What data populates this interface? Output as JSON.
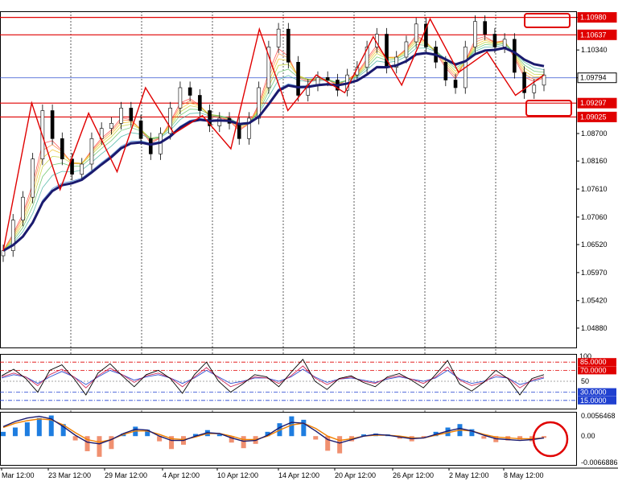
{
  "chart_data": [
    {
      "type": "candlestick",
      "title": "",
      "x": [
        "Mar 12:00",
        "23 Mar 12:00",
        "29 Mar 12:00",
        "4 Apr 12:00",
        "10 Apr 12:00",
        "14 Apr 12:00",
        "20 Apr 12:00",
        "26 Apr 12:00",
        "2 May 12:00",
        "8 May 12:00"
      ],
      "ylim": [
        1.045,
        1.111
      ],
      "ticks": [
        "1.10980",
        "1.10340",
        "1.09794",
        "1.08700",
        "1.08160",
        "1.07610",
        "1.07060",
        "1.06520",
        "1.05970",
        "1.05420",
        "1.04880"
      ],
      "closes": [
        1.064,
        1.07,
        1.0745,
        1.082,
        1.0915,
        1.086,
        1.082,
        1.079,
        1.081,
        1.086,
        1.088,
        1.089,
        1.092,
        1.0895,
        1.086,
        1.083,
        1.087,
        1.092,
        1.096,
        1.0945,
        1.0915,
        1.0885,
        1.09,
        1.089,
        1.086,
        1.09,
        1.096,
        1.104,
        1.1075,
        1.101,
        1.0945,
        1.0965,
        1.098,
        1.0975,
        1.0955,
        1.0985,
        1.1,
        1.104,
        1.1065,
        1.1,
        1.102,
        1.105,
        1.1085,
        1.104,
        1.101,
        1.0975,
        1.096,
        1.104,
        1.109,
        1.1065,
        1.104,
        1.1055,
        1.099,
        1.095,
        1.0965,
        1.0985
      ],
      "levels": [
        {
          "price": "1.10980",
          "color": "#e00000"
        },
        {
          "price": "1.10637",
          "color": "#e00000"
        },
        {
          "price": "1.09794",
          "color": "#3050d0"
        },
        {
          "price": "1.09297",
          "color": "#e00000"
        },
        {
          "price": "1.09025",
          "color": "#e00000"
        }
      ],
      "zigzag": [
        1.064,
        1.093,
        1.076,
        1.091,
        1.0795,
        1.096,
        1.087,
        1.0905,
        1.084,
        1.1075,
        1.0915,
        1.0985,
        1.095,
        1.106,
        1.0965,
        1.1095,
        1.099,
        1.103,
        1.0945,
        1.0985
      ],
      "ma_color": "#1a1a6e",
      "zigzag_color": "#e00000"
    },
    {
      "type": "line",
      "name": "rsi-panel",
      "ylim": [
        0,
        100
      ],
      "levels": [
        {
          "label": "85.0000",
          "value": 85,
          "color": "#e00000"
        },
        {
          "label": "70.0000",
          "value": 70,
          "color": "#e00000"
        },
        {
          "label": "50",
          "value": 50,
          "color": "#888888"
        },
        {
          "label": "30.0000",
          "value": 30,
          "color": "#2040d0"
        },
        {
          "label": "15.0000",
          "value": 15,
          "color": "#2040d0"
        }
      ],
      "top_label": "100",
      "series_black": [
        60,
        72,
        55,
        30,
        70,
        80,
        55,
        25,
        65,
        82,
        60,
        40,
        62,
        70,
        55,
        28,
        62,
        85,
        50,
        30,
        45,
        62,
        58,
        40,
        66,
        90,
        50,
        35,
        55,
        60,
        48,
        40,
        58,
        64,
        52,
        38,
        62,
        88,
        45,
        32,
        48,
        70,
        55,
        25,
        55,
        62
      ],
      "series_red": [
        58,
        65,
        58,
        42,
        62,
        72,
        58,
        38,
        60,
        74,
        62,
        48,
        60,
        65,
        56,
        40,
        58,
        75,
        56,
        40,
        48,
        58,
        56,
        46,
        60,
        78,
        56,
        44,
        54,
        58,
        50,
        46,
        56,
        60,
        54,
        46,
        58,
        76,
        52,
        42,
        48,
        62,
        56,
        38,
        52,
        58
      ],
      "series_blue": [
        56,
        62,
        58,
        46,
        58,
        68,
        58,
        44,
        58,
        70,
        62,
        52,
        58,
        62,
        56,
        46,
        56,
        70,
        58,
        46,
        50,
        56,
        56,
        50,
        58,
        72,
        58,
        48,
        54,
        56,
        52,
        48,
        54,
        58,
        54,
        50,
        56,
        70,
        54,
        46,
        50,
        58,
        56,
        44,
        50,
        56
      ]
    },
    {
      "type": "bar",
      "name": "macd-panel",
      "ylim": [
        -0.0066886,
        0.0056468
      ],
      "ticks": [
        "0.0056468",
        "0.00",
        "-0.0066886"
      ],
      "histogram": [
        0.001,
        0.002,
        0.0032,
        0.0042,
        0.0048,
        0.0028,
        -0.001,
        -0.0035,
        -0.0048,
        -0.003,
        0.0006,
        0.0022,
        0.0015,
        -0.0012,
        -0.003,
        -0.002,
        0.0005,
        0.0014,
        0.0004,
        -0.0015,
        -0.0028,
        -0.0018,
        0.001,
        0.003,
        0.0046,
        0.0038,
        -0.0008,
        -0.0034,
        -0.004,
        -0.0012,
        0.0004,
        0.0006,
        0.0004,
        -0.0006,
        -0.0012,
        -0.0004,
        0.001,
        0.002,
        0.0028,
        0.0016,
        -0.0006,
        -0.0014,
        -0.001,
        -0.0008,
        -0.0012,
        -0.0004
      ],
      "signal": [
        0.002,
        0.003,
        0.0036,
        0.004,
        0.0038,
        0.0026,
        0.0008,
        -0.0008,
        -0.0014,
        -0.0008,
        0.0004,
        0.0012,
        0.0012,
        0.0004,
        -0.0006,
        -0.0008,
        -0.0002,
        0.0006,
        0.0006,
        0.0,
        -0.0008,
        -0.0008,
        0.0,
        0.0014,
        0.0026,
        0.003,
        0.0018,
        0.0,
        -0.001,
        -0.0006,
        0.0,
        0.0002,
        0.0002,
        0.0,
        -0.0004,
        -0.0004,
        0.0002,
        0.0008,
        0.0014,
        0.0012,
        0.0004,
        -0.0002,
        -0.0004,
        -0.0006,
        -0.0006,
        -0.0004
      ],
      "macd": [
        0.0022,
        0.0034,
        0.0042,
        0.0046,
        0.004,
        0.0022,
        0.0002,
        -0.0014,
        -0.0018,
        -0.0008,
        0.0006,
        0.0016,
        0.0014,
        0.0,
        -0.001,
        -0.001,
        0.0,
        0.0008,
        0.0006,
        -0.0004,
        -0.0012,
        -0.001,
        0.0002,
        0.002,
        0.0032,
        0.003,
        0.0012,
        -0.0008,
        -0.0016,
        -0.0008,
        0.0,
        0.0004,
        0.0002,
        -0.0002,
        -0.0006,
        -0.0004,
        0.0004,
        0.0012,
        0.0018,
        0.0012,
        0.0002,
        -0.0006,
        -0.0008,
        -0.001,
        -0.0008,
        -0.0004
      ],
      "hist_pos_color": "#1e7de0",
      "hist_neg_color": "#f09070",
      "signal_color": "#f08000",
      "macd_color": "#1a1a6e",
      "highlight_color": "#e00000"
    }
  ]
}
